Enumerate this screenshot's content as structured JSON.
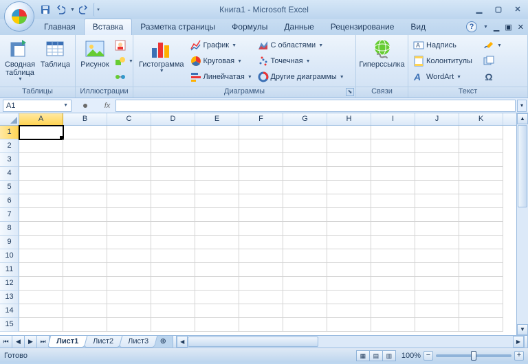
{
  "title": "Книга1 - Microsoft Excel",
  "qat": {
    "save": "save",
    "undo": "undo",
    "redo": "redo"
  },
  "tabs": {
    "home": "Главная",
    "insert": "Вставка",
    "pagelayout": "Разметка страницы",
    "formulas": "Формулы",
    "data": "Данные",
    "review": "Рецензирование",
    "view": "Вид",
    "active": "insert"
  },
  "ribbon": {
    "tables": {
      "label": "Таблицы",
      "pivot": "Сводная\nтаблица",
      "table": "Таблица"
    },
    "illus": {
      "label": "Иллюстрации",
      "picture": "Рисунок"
    },
    "charts": {
      "label": "Диаграммы",
      "histogram": "Гистограмма",
      "line": "График",
      "pie": "Круговая",
      "bar": "Линейчатая",
      "area": "С областями",
      "scatter": "Точечная",
      "other": "Другие диаграммы"
    },
    "links": {
      "label": "Связи",
      "hyperlink": "Гиперссылка"
    },
    "text": {
      "label": "Текст",
      "textbox": "Надпись",
      "headerfooter": "Колонтитулы",
      "wordart": "WordArt",
      "symbol": "Ω"
    }
  },
  "namebox": "A1",
  "columns": [
    "A",
    "B",
    "C",
    "D",
    "E",
    "F",
    "G",
    "H",
    "I",
    "J",
    "K"
  ],
  "rows": [
    1,
    2,
    3,
    4,
    5,
    6,
    7,
    8,
    9,
    10,
    11,
    12,
    13,
    14,
    15
  ],
  "active_cell": {
    "row": 1,
    "col": "A"
  },
  "sheets": {
    "s1": "Лист1",
    "s2": "Лист2",
    "s3": "Лист3",
    "active": "s1"
  },
  "status": {
    "ready": "Готово",
    "zoom": "100%"
  }
}
